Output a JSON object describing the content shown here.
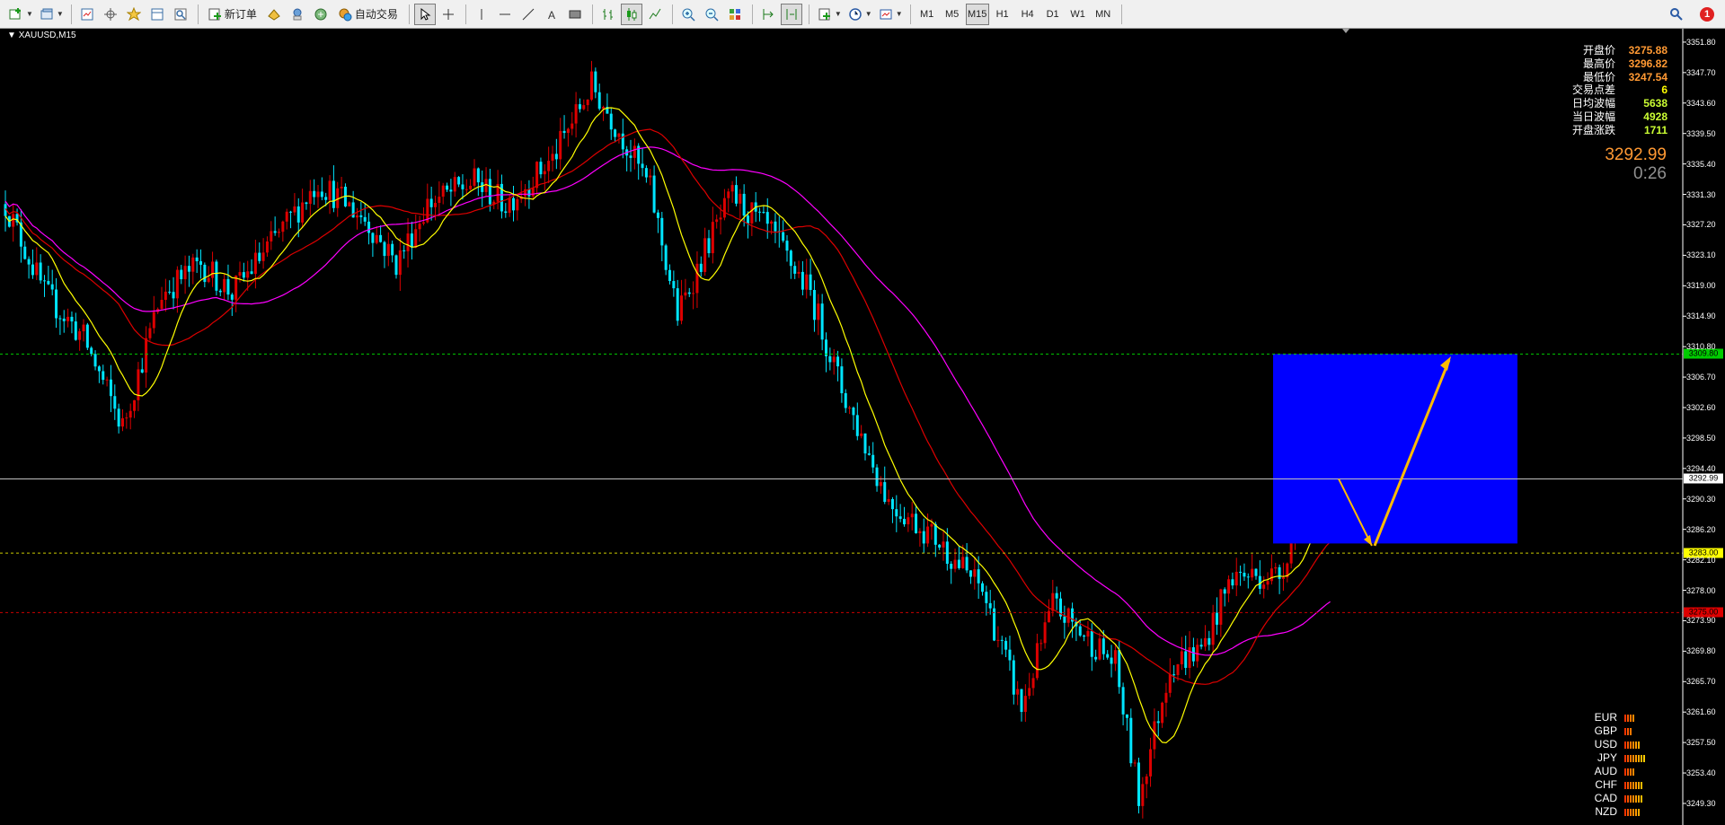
{
  "toolbar": {
    "new_order_label": "新订单",
    "auto_trade_label": "自动交易",
    "timeframes": [
      "M1",
      "M5",
      "M15",
      "H1",
      "H4",
      "D1",
      "W1",
      "MN"
    ],
    "active_timeframe": "M15",
    "alert_count": "1"
  },
  "chart": {
    "symbol_label": "XAUUSD,M15",
    "info": [
      {
        "label": "开盘价",
        "value": "3275.88",
        "color": "#ff9933"
      },
      {
        "label": "最高价",
        "value": "3296.82",
        "color": "#ff9933"
      },
      {
        "label": "最低价",
        "value": "3247.54",
        "color": "#ff9933"
      },
      {
        "label": "交易点差",
        "value": "6",
        "color": "#ffff00"
      },
      {
        "label": "日均波幅",
        "value": "5638",
        "color": "#ccff33"
      },
      {
        "label": "当日波幅",
        "value": "4928",
        "color": "#ccff33"
      },
      {
        "label": "开盘涨跌",
        "value": "1711",
        "color": "#ccff33"
      }
    ],
    "current_price": "3292.99",
    "countdown": "0:26",
    "price_axis": {
      "min": 3247.0,
      "max": 3353.0,
      "ticks": [
        "3351.80",
        "3347.70",
        "3343.60",
        "3339.50",
        "3335.40",
        "3331.30",
        "3327.20",
        "3323.10",
        "3319.00",
        "3314.90",
        "3310.80",
        "3306.70",
        "3302.60",
        "3298.50",
        "3294.40",
        "3290.30",
        "3286.20",
        "3282.10",
        "3278.00",
        "3273.90",
        "3269.80",
        "3265.70",
        "3261.60",
        "3257.50",
        "3253.40",
        "3249.30"
      ]
    },
    "levels": [
      {
        "price": 3309.8,
        "label": "3309.80",
        "color": "#00cc00",
        "tag_bg": "#00cc00",
        "tag_fg": "#000000",
        "style": "dashed"
      },
      {
        "price": 3292.99,
        "label": "3292.99",
        "color": "#c0c0c0",
        "tag_bg": "#ffffff",
        "tag_fg": "#000000",
        "style": "solid"
      },
      {
        "price": 3283.0,
        "label": "3283.00",
        "color": "#cccc00",
        "tag_bg": "#ffff00",
        "tag_fg": "#000000",
        "style": "dashed"
      },
      {
        "price": 3275.0,
        "label": "3275.00",
        "color": "#cc0000",
        "tag_bg": "#dd0000",
        "tag_fg": "#000000",
        "style": "dashed"
      }
    ],
    "candle_colors": {
      "up": "#dd0000",
      "down": "#00e5ff"
    },
    "ma_colors": {
      "fast": "#ffff00",
      "mid": "#dd0000",
      "slow": "#ff00ff"
    },
    "box_color": "#0000ff",
    "arrow_color": "#ffbb00"
  },
  "currency_strength": [
    {
      "name": "EUR",
      "bars": 4
    },
    {
      "name": "GBP",
      "bars": 3
    },
    {
      "name": "USD",
      "bars": 6
    },
    {
      "name": "JPY",
      "bars": 8
    },
    {
      "name": "AUD",
      "bars": 4
    },
    {
      "name": "CHF",
      "bars": 7
    },
    {
      "name": "CAD",
      "bars": 7
    },
    {
      "name": "NZD",
      "bars": 6
    }
  ]
}
